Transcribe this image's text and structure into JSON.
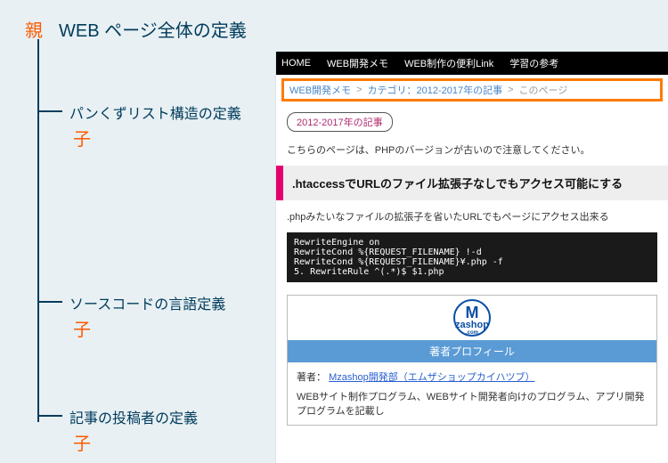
{
  "diagram": {
    "parent_label": "親",
    "title": "WEB ページ全体の定義",
    "children": [
      {
        "label": "パンくずリスト構造の定義",
        "child_word": "子"
      },
      {
        "label": "ソースコードの言語定義",
        "child_word": "子"
      },
      {
        "label": "記事の投稿者の定義",
        "child_word": "子"
      }
    ]
  },
  "sample_page": {
    "nav": [
      "HOME",
      "WEB開発メモ",
      "WEB制作の便利Link",
      "学習の参考"
    ],
    "breadcrumb": {
      "part1": "WEB開発メモ",
      "sep": ">",
      "part2": "カテゴリ：2012-2017年の記事",
      "part3": "このページ"
    },
    "tag": "2012-2017年の記事",
    "notice": "こちらのページは、PHPのバージョンが古いので注意してください。",
    "article": {
      "heading": ".htaccessでURLのファイル拡張子なしでもアクセス可能にする",
      "desc": ".phpみたいなファイルの拡張子を省いたURLでもページにアクセス出来る",
      "code": [
        "RewriteEngine on",
        "RewriteCond %{REQUEST_FILENAME} !-d",
        "RewriteCond %{REQUEST_FILENAME}¥.php -f",
        "RewriteRule ^(.*)$ $1.php"
      ]
    },
    "profile": {
      "logo_big": "M",
      "logo_mid": "zashop",
      "logo_sub": ".com",
      "bar": "著者プロフィール",
      "author_prefix": "著者：",
      "author_link": "Mzashop開発部（エムザショップカイハツブ）",
      "bio": "WEBサイト制作プログラム、WEBサイト開発者向けのプログラム、アプリ開発プログラムを記載し"
    }
  }
}
